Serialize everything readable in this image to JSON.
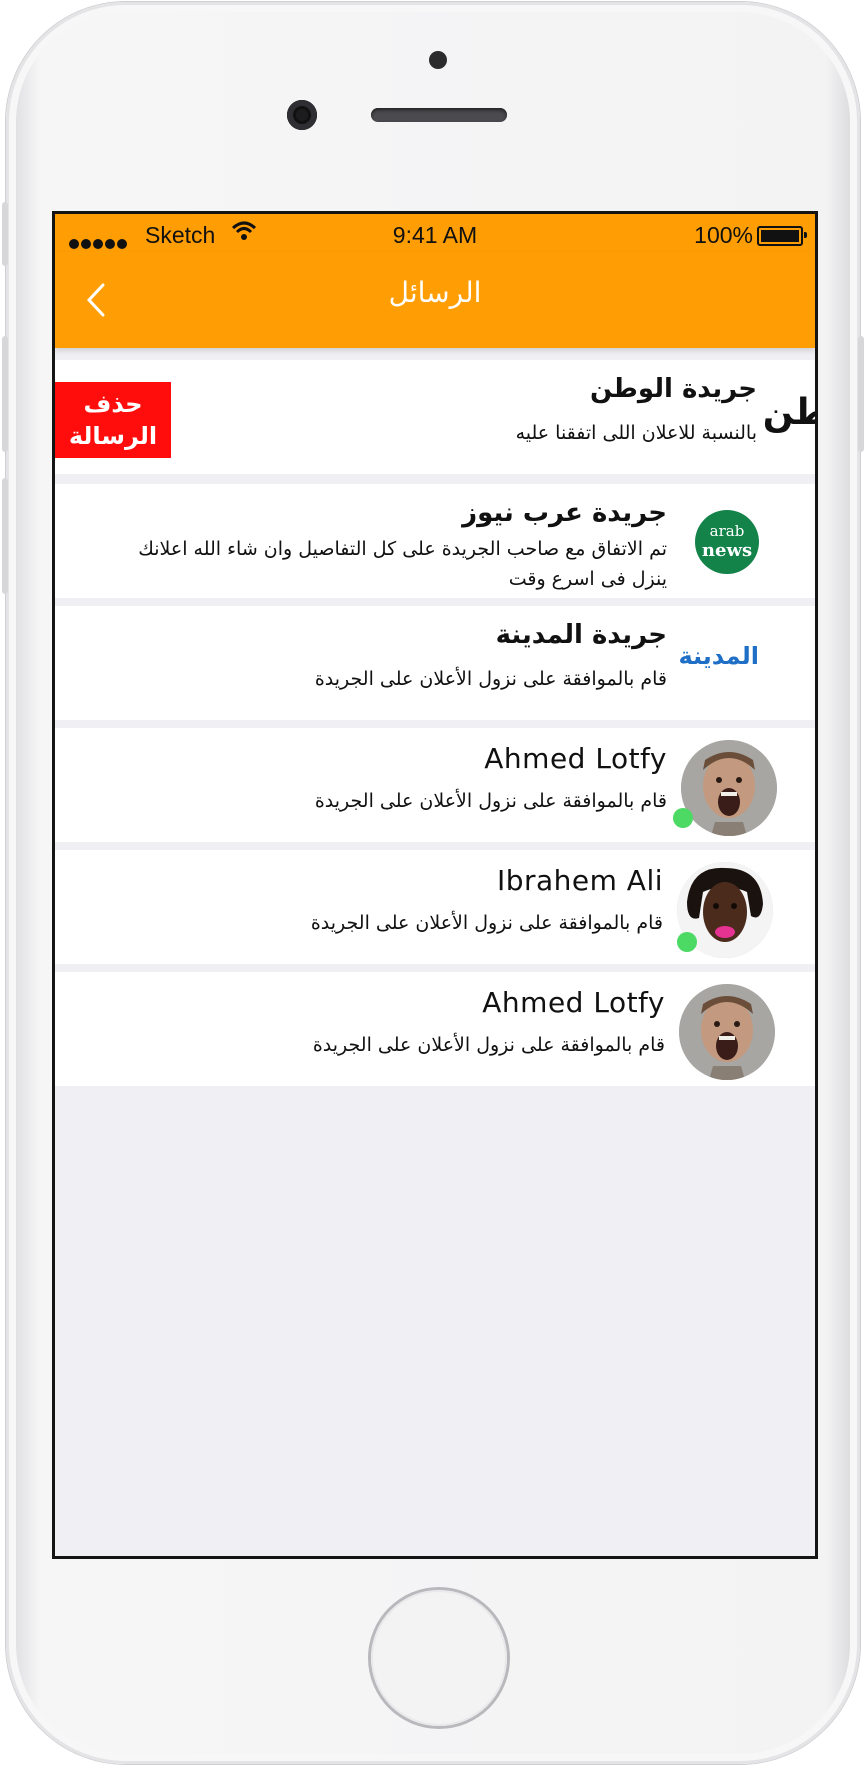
{
  "statusbar": {
    "carrier": "Sketch",
    "time": "9:41 AM",
    "battery": "100%"
  },
  "navbar": {
    "title": "الرسائل",
    "back_icon": "chevron-left-icon"
  },
  "messages": [
    {
      "name": "جريدة الوطن",
      "text": "بالنسبة للاعلان اللى اتفقنا عليه",
      "logo_text": "طن",
      "delete_label_1": "حذف",
      "delete_label_2": "الرسالة"
    },
    {
      "name": "جريدة عرب نيوز",
      "text": "تم الاتفاق مع صاحب الجريدة على كل التفاصيل وان شاء الله اعلانك ينزل فى اسرع وقت",
      "logo_text_1": "arab",
      "logo_text_2": "news"
    },
    {
      "name": "جريدة المدينة",
      "text": "قام بالموافقة على نزول الأعلان على الجريدة",
      "logo_text": "المدينة"
    },
    {
      "name": "Ahmed Lotfy",
      "text": "قام بالموافقة على نزول الأعلان على الجريدة",
      "online": true
    },
    {
      "name": "Ibrahem Ali",
      "text": "قام بالموافقة على نزول الأعلان على الجريدة",
      "online": true
    },
    {
      "name": "Ahmed Lotfy",
      "text": "قام بالموافقة على نزول الأعلان على الجريدة",
      "online": false
    }
  ],
  "colors": {
    "accent": "#ff9d04",
    "delete": "#ff0d0d",
    "online": "#4cd964",
    "background": "#efeff4"
  }
}
